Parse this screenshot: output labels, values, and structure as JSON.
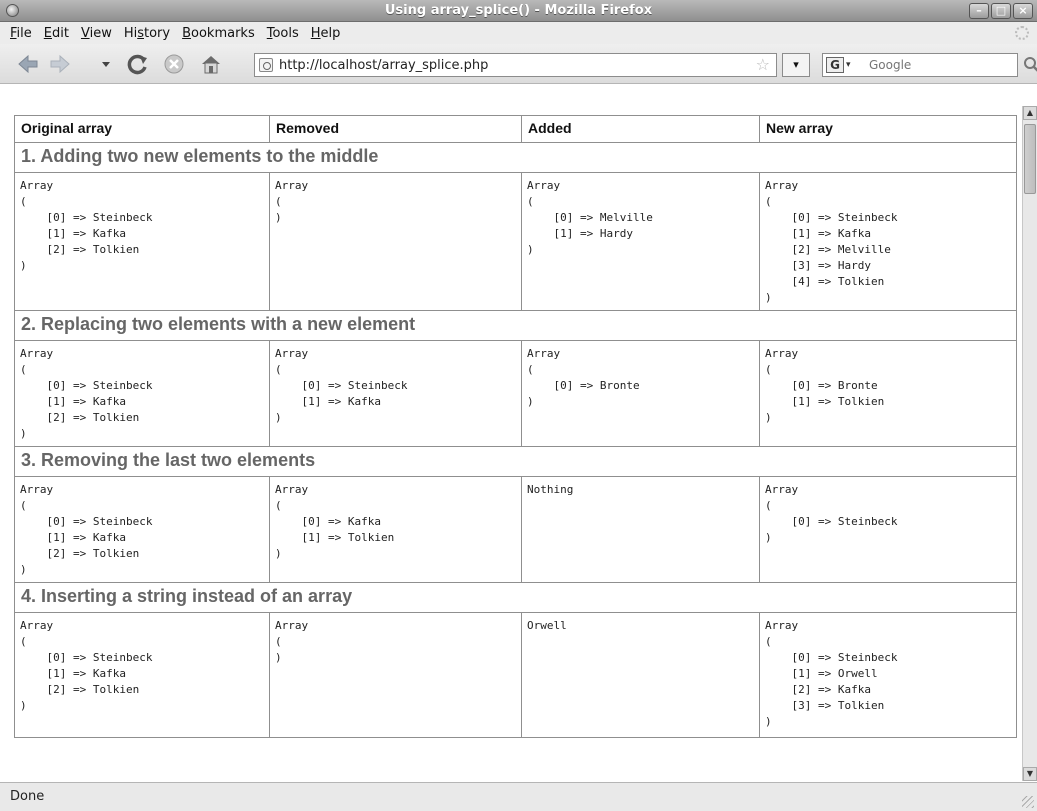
{
  "window": {
    "title": "Using array_splice() - Mozilla Firefox"
  },
  "menu": {
    "items": [
      {
        "first": "F",
        "rest": "ile"
      },
      {
        "first": "E",
        "rest": "dit"
      },
      {
        "first": "V",
        "rest": "iew"
      },
      {
        "pre": "Hi",
        "first": "s",
        "rest": "tory"
      },
      {
        "first": "B",
        "rest": "ookmarks"
      },
      {
        "first": "T",
        "rest": "ools"
      },
      {
        "first": "H",
        "rest": "elp"
      }
    ]
  },
  "nav": {
    "url": "http://localhost/array_splice.php",
    "search_placeholder": "Google"
  },
  "table": {
    "headers": [
      "Original array",
      "Removed",
      "Added",
      "New array"
    ],
    "sections": [
      {
        "title": "1. Adding two new elements to the middle",
        "cells": [
          "Array\n(\n    [0] => Steinbeck\n    [1] => Kafka\n    [2] => Tolkien\n)",
          "Array\n(\n)",
          "Array\n(\n    [0] => Melville\n    [1] => Hardy\n)",
          "Array\n(\n    [0] => Steinbeck\n    [1] => Kafka\n    [2] => Melville\n    [3] => Hardy\n    [4] => Tolkien\n)"
        ]
      },
      {
        "title": "2. Replacing two elements with a new element",
        "cells": [
          "Array\n(\n    [0] => Steinbeck\n    [1] => Kafka\n    [2] => Tolkien\n)",
          "Array\n(\n    [0] => Steinbeck\n    [1] => Kafka\n)",
          "Array\n(\n    [0] => Bronte\n)",
          "Array\n(\n    [0] => Bronte\n    [1] => Tolkien\n)"
        ]
      },
      {
        "title": "3. Removing the last two elements",
        "cells": [
          "Array\n(\n    [0] => Steinbeck\n    [1] => Kafka\n    [2] => Tolkien\n)",
          "Array\n(\n    [0] => Kafka\n    [1] => Tolkien\n)",
          "Nothing",
          "Array\n(\n    [0] => Steinbeck\n)"
        ]
      },
      {
        "title": "4. Inserting a string instead of an array",
        "cells": [
          "Array\n(\n    [0] => Steinbeck\n    [1] => Kafka\n    [2] => Tolkien\n)",
          "Array\n(\n)",
          "Orwell",
          "Array\n(\n    [0] => Steinbeck\n    [1] => Orwell\n    [2] => Kafka\n    [3] => Tolkien\n)"
        ]
      }
    ]
  },
  "status": {
    "text": "Done"
  }
}
